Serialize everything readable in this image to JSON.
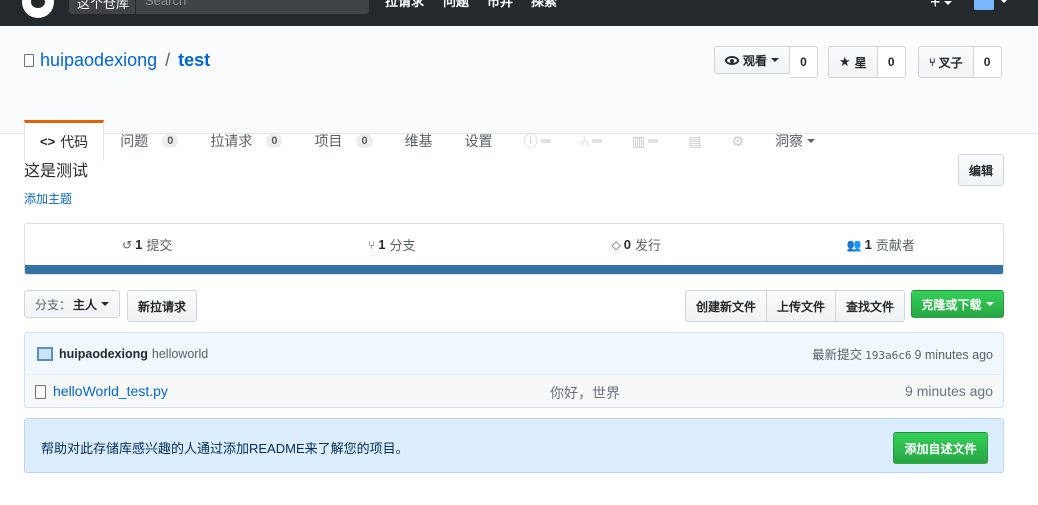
{
  "header": {
    "scope_label": "这个仓库",
    "search_placeholder": "Search",
    "nav": [
      "拉请求",
      "问题",
      "市井",
      "探索"
    ],
    "plus": "+"
  },
  "repo": {
    "owner": "huipaodexiong",
    "separator": "/",
    "name": "test"
  },
  "actions": {
    "watch_label": "观看",
    "watch_count": "0",
    "star_label": "星",
    "star_count": "0",
    "fork_label": "叉子",
    "fork_count": "0"
  },
  "tabs": {
    "code": "代码",
    "issues": "问题",
    "issues_count": "0",
    "pulls": "拉请求",
    "pulls_count": "0",
    "projects": "项目",
    "projects_count": "0",
    "wiki": "维基",
    "settings": "设置",
    "insights": "洞察"
  },
  "description": {
    "text": "这是测试",
    "add_topics": "添加主题",
    "edit": "编辑"
  },
  "summary": {
    "commits_num": "1",
    "commits_label": "提交",
    "branches_num": "1",
    "branches_label": "分支",
    "releases_num": "0",
    "releases_label": "发行",
    "contributors_num": "1",
    "contributors_label": "贡献者",
    "language_color": "#3572a5"
  },
  "filenav": {
    "branch_label": "分支：",
    "branch_value": "主人",
    "new_pr": "新拉请求",
    "create_file": "创建新文件",
    "upload_files": "上传文件",
    "find_file": "查找文件",
    "clone": "克隆或下载"
  },
  "commit": {
    "author": "huipaodexiong",
    "message": "helloworld",
    "latest_label": "最新提交",
    "sha": "193a6c6",
    "age": "9 minutes ago"
  },
  "files": [
    {
      "name": "helloWorld_test.py",
      "message": "你好，世界",
      "age": "9 minutes ago"
    }
  ],
  "readme_prompt": {
    "text": "帮助对此存储库感兴趣的人通过添加README来了解您的项目。",
    "button": "添加自述文件"
  }
}
